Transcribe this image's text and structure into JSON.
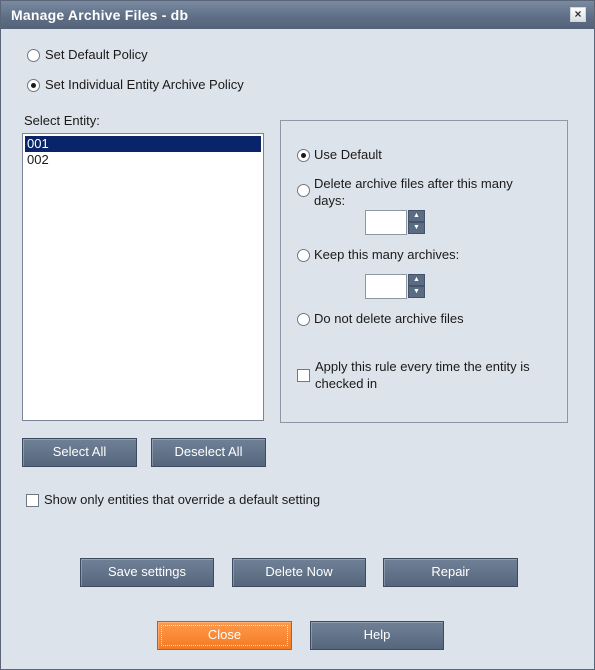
{
  "window": {
    "title": "Manage Archive Files - db",
    "close_glyph": "×"
  },
  "policy": {
    "default_label": "Set Default Policy",
    "individual_label": "Set Individual Entity Archive Policy",
    "selected": "individual"
  },
  "entities": {
    "label": "Select Entity:",
    "items": [
      "001",
      "002"
    ],
    "selected_index": 0
  },
  "options": {
    "use_default": "Use Default",
    "delete_after_line1": "Delete archive files after this many",
    "delete_after_line2": "days:",
    "keep_archives": "Keep this many archives:",
    "do_not_delete": "Do not delete archive files",
    "apply_rule_line1": "Apply this rule every time the entity is",
    "apply_rule_line2": "checked in",
    "selected": "use_default"
  },
  "buttons": {
    "select_all": "Select All",
    "deselect_all": "Deselect All",
    "save_settings": "Save settings",
    "delete_now": "Delete Now",
    "repair": "Repair",
    "close": "Close",
    "help": "Help"
  },
  "filter": {
    "show_overrides": "Show only entities that override a default setting"
  },
  "colors": {
    "title_bar": "#5d6d84",
    "dialog_bg": "#dde3ea",
    "button": "#5a6b82",
    "accent_button": "#f57a24",
    "selection": "#0a246a"
  },
  "icons": {
    "spinner_up": "up-arrow-icon",
    "spinner_down": "down-arrow-icon"
  }
}
